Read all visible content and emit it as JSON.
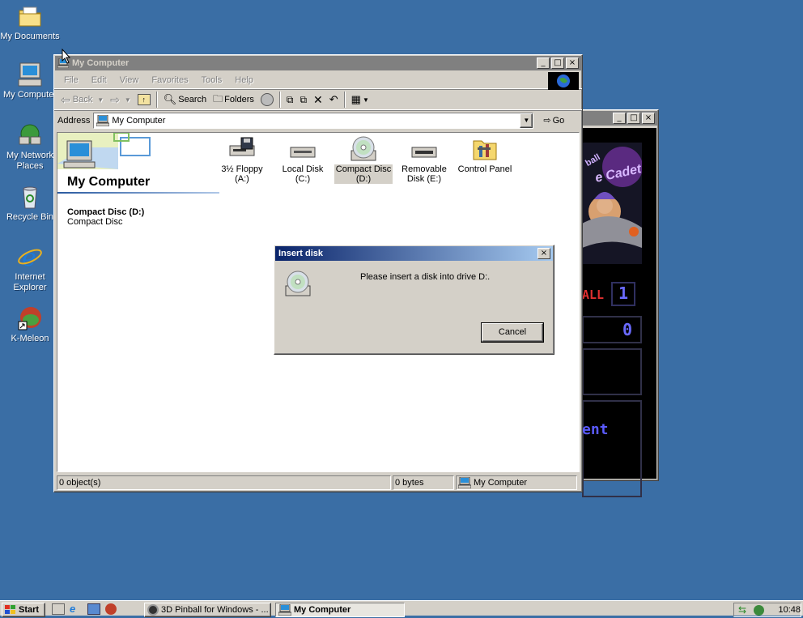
{
  "desktop": {
    "icons": [
      {
        "label": "My Documents",
        "icon": "folder-documents-icon"
      },
      {
        "label": "My Computer",
        "icon": "computer-icon"
      },
      {
        "label": "My Network Places",
        "icon": "network-icon"
      },
      {
        "label": "Recycle Bin",
        "icon": "recycle-bin-icon"
      },
      {
        "label": "Internet Explorer",
        "icon": "internet-explorer-icon"
      },
      {
        "label": "K-Meleon",
        "icon": "k-meleon-icon"
      }
    ]
  },
  "pinball_window": {
    "art_texts": [
      "ball",
      "e Cadet",
      "ALL",
      "1",
      "0",
      "ent"
    ]
  },
  "explorer": {
    "title": "My Computer",
    "menu": [
      "File",
      "Edit",
      "View",
      "Favorites",
      "Tools",
      "Help"
    ],
    "toolbar": {
      "back": "Back",
      "search": "Search",
      "folders": "Folders"
    },
    "address": {
      "label": "Address",
      "value": "My Computer",
      "go": "Go"
    },
    "left_panel": {
      "heading": "My Computer",
      "selected_title": "Compact Disc (D:)",
      "selected_subtitle": "Compact Disc"
    },
    "items": [
      {
        "line1": "3½ Floppy",
        "line2": "(A:)",
        "icon": "floppy-drive-icon"
      },
      {
        "line1": "Local Disk (C:)",
        "line2": "",
        "icon": "hard-disk-icon"
      },
      {
        "line1": "Compact Disc",
        "line2": "(D:)",
        "icon": "cd-drive-icon"
      },
      {
        "line1": "Removable",
        "line2": "Disk (E:)",
        "icon": "removable-disk-icon"
      },
      {
        "line1": "Control Panel",
        "line2": "",
        "icon": "control-panel-icon"
      }
    ],
    "status": {
      "objects": "0 object(s)",
      "size": "0 bytes",
      "zone": "My Computer"
    }
  },
  "dialog": {
    "title": "Insert disk",
    "message": "Please insert a disk into drive D:.",
    "cancel": "Cancel"
  },
  "taskbar": {
    "start": "Start",
    "tasks": [
      "3D Pinball for Windows - ...",
      "My Computer"
    ],
    "clock": "10:48"
  },
  "colors": {
    "desktop": "#3a6ea5",
    "title_active": "#0a246a",
    "title_inactive": "#808080",
    "face": "#d4d0c8"
  }
}
